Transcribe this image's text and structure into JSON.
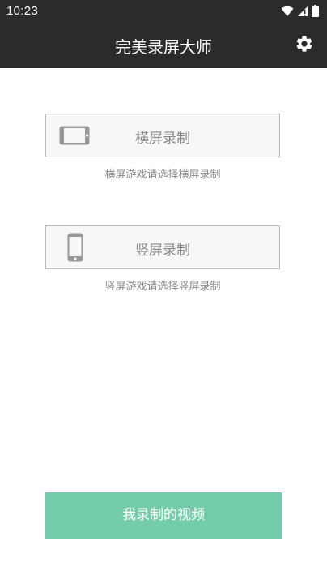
{
  "status_bar": {
    "time": "10:23",
    "icons": [
      "wifi-icon",
      "signal-icon",
      "battery-icon"
    ]
  },
  "app_bar": {
    "title": "完美录屏大师",
    "settings_icon": "gear-icon"
  },
  "landscape": {
    "label": "横屏录制",
    "hint": "横屏游戏请选择横屏录制",
    "icon": "phone-landscape-icon"
  },
  "portrait": {
    "label": "竖屏录制",
    "hint": "竖屏游戏请选择竖屏录制",
    "icon": "phone-portrait-icon"
  },
  "videos_button": {
    "label": "我录制的视频"
  },
  "colors": {
    "bar_background": "#2b2b2b",
    "accent": "#73cdaa",
    "button_border": "#b9b9b9",
    "label_gray": "#888888"
  }
}
